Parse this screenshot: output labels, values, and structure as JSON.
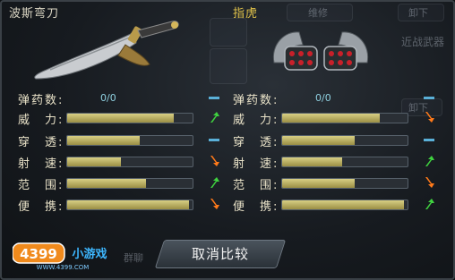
{
  "left_weapon": {
    "name": "波斯弯刀",
    "ammo_label": "弹药数:",
    "ammo_value": "0/0",
    "stats": [
      {
        "label": "威　力:",
        "value": 0.85,
        "indicator": "up"
      },
      {
        "label": "穿　透:",
        "value": 0.58,
        "indicator": "neutral"
      },
      {
        "label": "射　速:",
        "value": 0.43,
        "indicator": "down"
      },
      {
        "label": "范　围:",
        "value": 0.63,
        "indicator": "up"
      },
      {
        "label": "便　携:",
        "value": 0.97,
        "indicator": "down"
      }
    ]
  },
  "right_weapon": {
    "name": "指虎",
    "ammo_label": "弹药数:",
    "ammo_value": "0/0",
    "stats": [
      {
        "label": "威　力:",
        "value": 0.78,
        "indicator": "down"
      },
      {
        "label": "穿　透:",
        "value": 0.58,
        "indicator": "neutral"
      },
      {
        "label": "射　速:",
        "value": 0.48,
        "indicator": "up"
      },
      {
        "label": "范　围:",
        "value": 0.58,
        "indicator": "down"
      },
      {
        "label": "便　携:",
        "value": 0.97,
        "indicator": "up"
      }
    ]
  },
  "background": {
    "repair": "维修",
    "unload_top": "卸下",
    "melee": "近战武器",
    "unload_mid": "卸下",
    "chat": "群聊"
  },
  "cancel_compare_label": "取消比较",
  "logo": {
    "brand": "4399",
    "game": "小游戏",
    "url": "WWW.4399.COM"
  },
  "colors": {
    "up": "#3fd23f",
    "down": "#ff7a1a",
    "neutral": "#5ab0d8",
    "bar_fill": "#cfc57a"
  }
}
